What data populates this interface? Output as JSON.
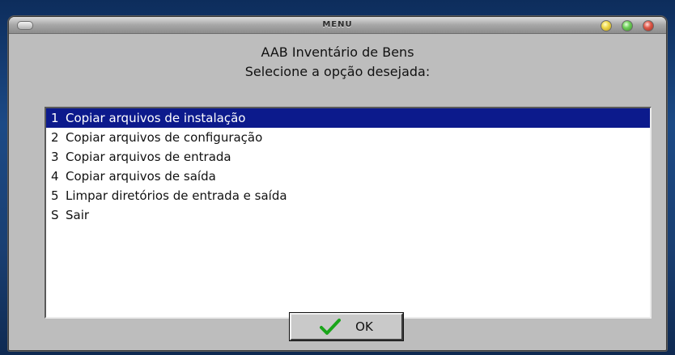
{
  "window": {
    "title": "MENU",
    "menu_icon": "window-menu-icon",
    "controls": {
      "minimize_icon": "minimize-icon",
      "maximize_icon": "maximize-icon",
      "close_icon": "close-icon"
    }
  },
  "header": {
    "title": "AAB Inventário de Bens",
    "subtitle": "Selecione a opção desejada:"
  },
  "menu": {
    "items": [
      {
        "key": "1",
        "label": "Copiar arquivos de instalação",
        "selected": true
      },
      {
        "key": "2",
        "label": "Copiar arquivos de configuração",
        "selected": false
      },
      {
        "key": "3",
        "label": "Copiar arquivos de entrada",
        "selected": false
      },
      {
        "key": "4",
        "label": "Copiar arquivos de saída",
        "selected": false
      },
      {
        "key": "5",
        "label": "Limpar diretórios de entrada e saída",
        "selected": false
      },
      {
        "key": "S",
        "label": "Sair",
        "selected": false
      }
    ]
  },
  "ok_button": {
    "label": "OK",
    "icon": "checkmark-icon"
  },
  "colors": {
    "selection": "#0c1a8c",
    "checkmark": "#1aa51a"
  }
}
